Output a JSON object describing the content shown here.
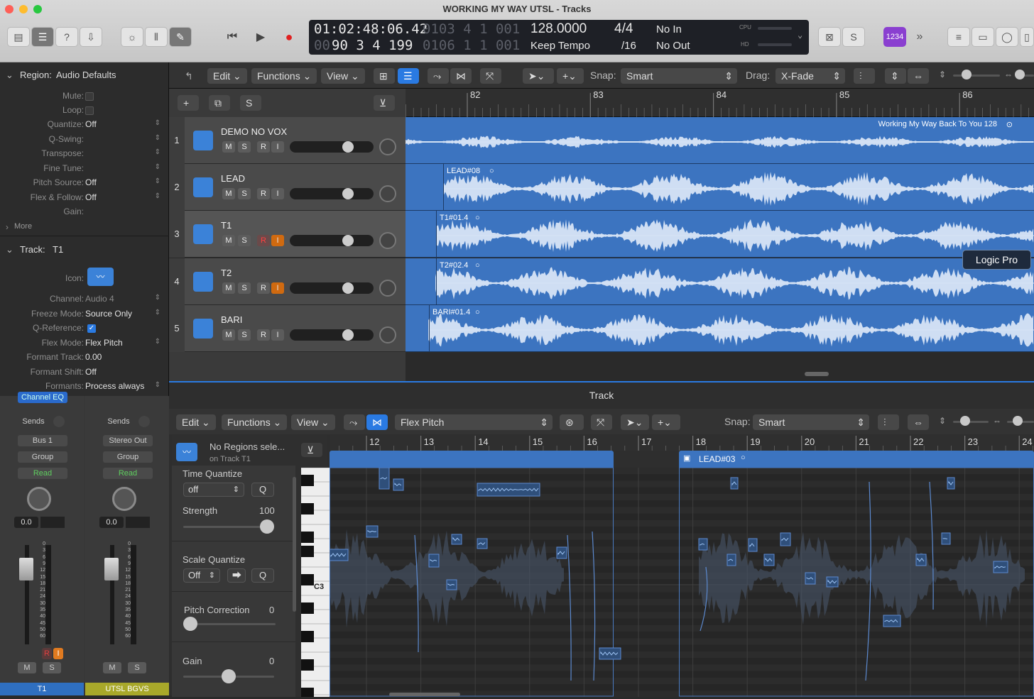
{
  "window": {
    "title": "WORKING MY WAY UTSL - Tracks"
  },
  "lcd": {
    "time": "01:02:48:06.42",
    "bars_dim": "0103 4 1 001",
    "sub1": "90 3 4 199",
    "sub1_dim": "00",
    "bars2_dim": "0106 1 1 001",
    "tempo": "128.0000",
    "tempo_mode": "Keep Tempo",
    "sig": "4/4",
    "div": "/16",
    "in": "No In",
    "out": "No Out",
    "cpu_label": "CPU",
    "hd_label": "HD"
  },
  "toolbar": {
    "counter_badge": "1234"
  },
  "inspector": {
    "region_header": "Region:",
    "region_name": "Audio Defaults",
    "region_rows": [
      {
        "key": "Mute:",
        "value": ""
      },
      {
        "key": "Loop:",
        "value": ""
      },
      {
        "key": "Quantize:",
        "value": "Off"
      },
      {
        "key": "Q-Swing:",
        "value": ""
      },
      {
        "key": "Transpose:",
        "value": ""
      },
      {
        "key": "Fine Tune:",
        "value": ""
      },
      {
        "key": "Pitch Source:",
        "value": "Off"
      },
      {
        "key": "Flex & Follow:",
        "value": "Off"
      },
      {
        "key": "Gain:",
        "value": ""
      }
    ],
    "more": "More",
    "track_header": "Track:",
    "track_name": "T1",
    "icon_label": "Icon:",
    "track_rows": [
      {
        "key": "Channel:",
        "value": "Audio 4"
      },
      {
        "key": "Freeze Mode:",
        "value": "Source Only"
      },
      {
        "key": "Q-Reference:",
        "value": "✓"
      },
      {
        "key": "Flex Mode:",
        "value": "Flex Pitch"
      },
      {
        "key": "Formant Track:",
        "value": "0.00"
      },
      {
        "key": "Formant Shift:",
        "value": "Off"
      },
      {
        "key": "Formants:",
        "value": "Process always"
      }
    ]
  },
  "strips": [
    {
      "top": "Channel EQ",
      "sends": "Sends",
      "bus": "Bus 1",
      "group": "Group",
      "auto": "Read",
      "value": "0.0",
      "name": "T1",
      "name_color": "#2f6fc0"
    },
    {
      "top": "",
      "sends": "Sends",
      "bus": "Stereo Out",
      "group": "Group",
      "auto": "Read",
      "value": "0.0",
      "name": "UTSL BGVS",
      "name_color": "#a8a82a"
    }
  ],
  "strip_scale": [
    "0",
    "3",
    "6",
    "9",
    "12",
    "15",
    "18",
    "21",
    "24",
    "30",
    "35",
    "40",
    "45",
    "50",
    "60"
  ],
  "strip_btns": {
    "mute": "M",
    "solo": "S",
    "rec": "R",
    "input": "I"
  },
  "tracks_toolbar": {
    "edit": "Edit",
    "functions": "Functions",
    "view": "View",
    "snap_label": "Snap:",
    "snap_value": "Smart",
    "drag_label": "Drag:",
    "drag_value": "X-Fade"
  },
  "ruler": [
    "82",
    "83",
    "84",
    "85",
    "86"
  ],
  "tracks": [
    {
      "num": "1",
      "name": "DEMO NO VOX",
      "region": "Working My Way Back To You 128"
    },
    {
      "num": "2",
      "name": "LEAD",
      "region": "LEAD#08"
    },
    {
      "num": "3",
      "name": "T1",
      "region": "T1#01.4"
    },
    {
      "num": "4",
      "name": "T2",
      "region": "T2#02.4"
    },
    {
      "num": "5",
      "name": "BARI",
      "region": "BARI#01.4"
    }
  ],
  "tooltip": "Logic Pro",
  "editor": {
    "title": "Track",
    "edit": "Edit",
    "functions": "Functions",
    "view": "View",
    "mode": "Flex Pitch",
    "snap_label": "Snap:",
    "snap_value": "Smart",
    "no_regions": "No Regions sele...",
    "on_track": "on Track T1",
    "time_quantize": "Time Quantize",
    "tq_value": "off",
    "q_btn": "Q",
    "strength_label": "Strength",
    "strength_value": "100",
    "scale_quantize": "Scale Quantize",
    "sq_value": "Off",
    "pitch_correction": "Pitch Correction",
    "pc_value": "0",
    "gain_label": "Gain",
    "gain_value": "0",
    "c3": "C3",
    "ruler": [
      "12",
      "13",
      "14",
      "15",
      "16",
      "17",
      "18",
      "19",
      "20",
      "21",
      "22",
      "23",
      "24"
    ],
    "region2": "LEAD#03"
  }
}
